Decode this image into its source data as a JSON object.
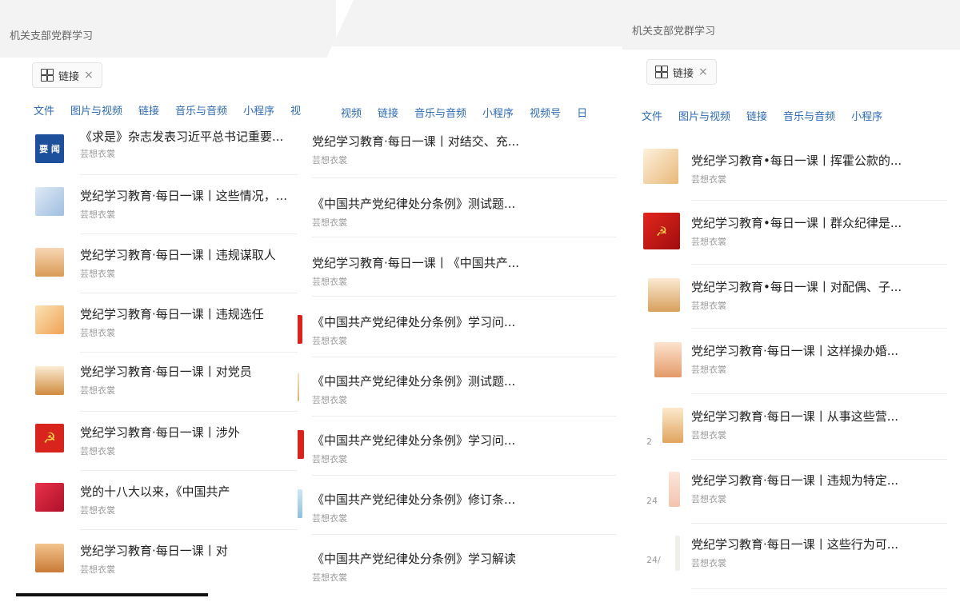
{
  "left": {
    "title": "机关支部党群学习",
    "chip": {
      "label": "链接",
      "close": "×",
      "icon": "grid-icon"
    },
    "tabs": [
      "文件",
      "图片与视频",
      "链接",
      "音乐与音频",
      "小程序",
      "视"
    ],
    "items": [
      {
        "title": "《求是》杂志发表习近平总书记重要...",
        "source": "芸想衣裳",
        "icon": "news-thumbnail"
      },
      {
        "title": "党纪学习教育·每日一课丨这些情况，...",
        "source": "芸想衣裳",
        "icon": "building-thumbnail"
      },
      {
        "title": "党纪学习教育·每日一课丨违规谋取人",
        "source": "芸想衣裳",
        "icon": "crowd-thumbnail"
      },
      {
        "title": "党纪学习教育·每日一课丨违规选任",
        "source": "芸想衣裳",
        "icon": "book-thumbnail"
      },
      {
        "title": "党纪学习教育·每日一课丨对党员",
        "source": "芸想衣裳",
        "icon": "figure-thumbnail"
      },
      {
        "title": "党纪学习教育·每日一课丨涉外",
        "source": "芸想衣裳",
        "icon": "party-emblem-thumbnail"
      },
      {
        "title": "党的十八大以来，《中国共产",
        "source": "芸想衣裳",
        "icon": "pen-thumbnail"
      },
      {
        "title": "党纪学习教育·每日一课丨对",
        "source": "芸想衣裳",
        "icon": "person-thumbnail"
      }
    ]
  },
  "middle": {
    "tabs": [
      "视频",
      "链接",
      "音乐与音频",
      "小程序",
      "视频号",
      "日"
    ],
    "items": [
      {
        "title": "党纪学习教育·每日一课丨对结交、充...",
        "source": "芸想衣裳"
      },
      {
        "title": "《中国共产党纪律处分条例》测试题...",
        "source": "芸想衣裳"
      },
      {
        "title": "党纪学习教育·每日一课丨《中国共产...",
        "source": "芸想衣裳"
      },
      {
        "title": "《中国共产党纪律处分条例》学习问...",
        "source": "芸想衣裳"
      },
      {
        "title": "《中国共产党纪律处分条例》测试题...",
        "source": "芸想衣裳"
      },
      {
        "title": "《中国共产党纪律处分条例》学习问...",
        "source": "芸想衣裳"
      },
      {
        "title": "《中国共产党纪律处分条例》修订条...",
        "source": "芸想衣裳"
      },
      {
        "title": "《中国共产党纪律处分条例》学习解读",
        "source": "芸想衣裳"
      }
    ]
  },
  "right": {
    "title": "机关支部党群学习",
    "chip": {
      "label": "链接",
      "close": "×",
      "icon": "grid-icon"
    },
    "tabs": [
      "文件",
      "图片与视频",
      "链接",
      "音乐与音频",
      "小程序"
    ],
    "items": [
      {
        "title": "党纪学习教育•每日一课丨挥霍公款的...",
        "source": "芸想衣裳",
        "icon": "desk-thumbnail"
      },
      {
        "title": "党纪学习教育•每日一课丨群众纪律是...",
        "source": "芸想衣裳",
        "icon": "party-flag-thumbnail"
      },
      {
        "title": "党纪学习教育•每日一课丨对配偶、子...",
        "source": "芸想衣裳",
        "icon": "scale-thumbnail"
      },
      {
        "title": "党纪学习教育·每日一课丨这样操办婚...",
        "source": "芸想衣裳",
        "icon": "wedding-thumbnail"
      },
      {
        "title": "党纪学习教育·每日一课丨从事这些营...",
        "source": "芸想衣裳",
        "icon": "business-thumbnail"
      },
      {
        "title": "党纪学习教育·每日一课丨违规为特定...",
        "source": "芸想衣裳",
        "icon": "doc-thumbnail"
      },
      {
        "title": "党纪学习教育·每日一课丨这些行为可...",
        "source": "芸想衣裳",
        "icon": "doc-thumbnail"
      }
    ],
    "side_marks": [
      "2",
      "24",
      "24/"
    ]
  }
}
